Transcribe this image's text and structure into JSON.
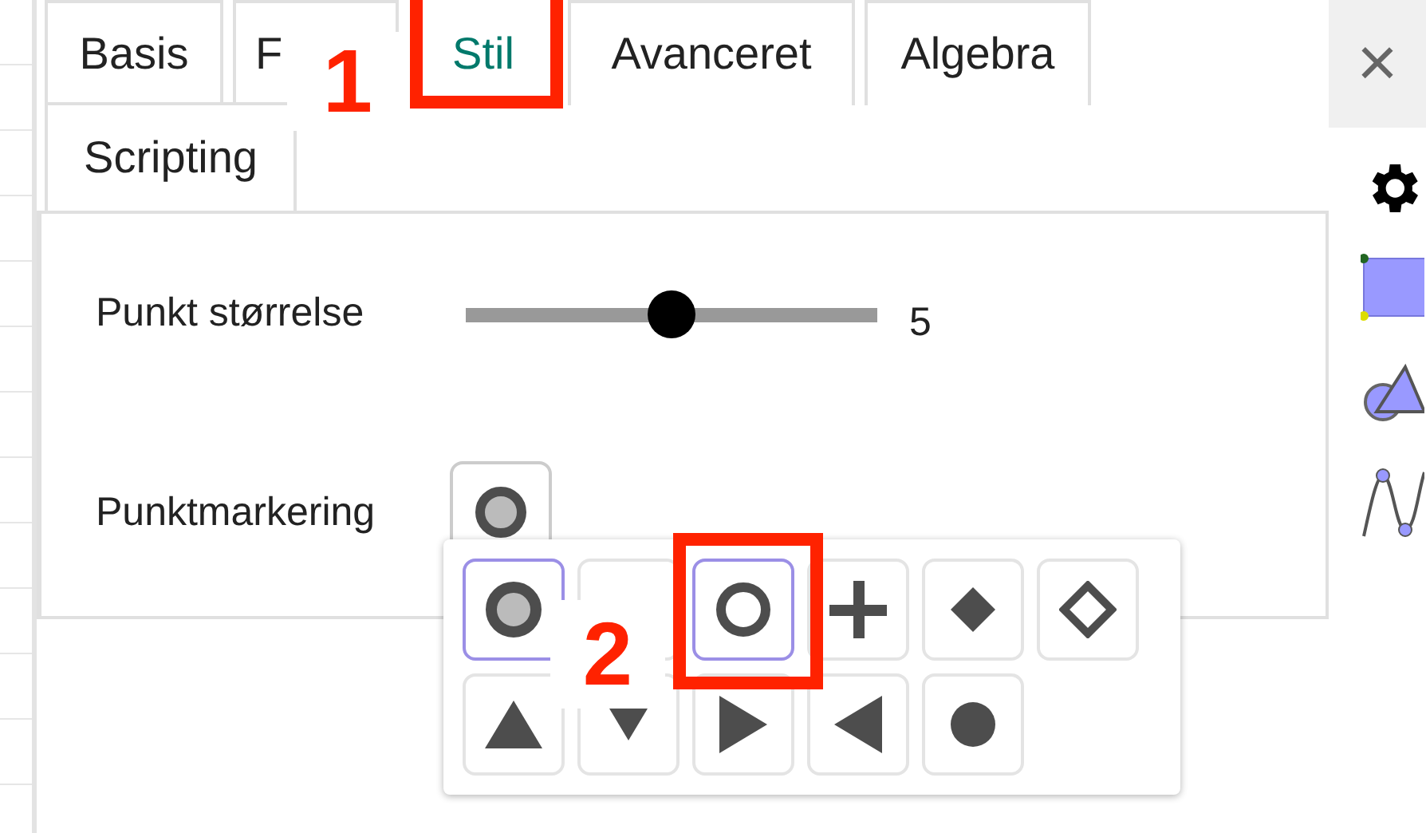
{
  "tab_rows": [
    [
      {
        "label": "Basis",
        "selected": false
      },
      {
        "label": "F",
        "selected": false
      },
      {
        "label": "Stil",
        "selected": true
      },
      {
        "label": "Avanceret",
        "selected": false
      },
      {
        "label": "Algebra",
        "selected": false
      }
    ],
    [
      {
        "label": "Scripting",
        "selected": false
      }
    ]
  ],
  "point_size": {
    "label": "Punkt størrelse",
    "level": 0.5,
    "reading": "5"
  },
  "point_style": {
    "label": "Punktmarkering",
    "kind": "ring_filled"
  },
  "style_options": [
    {
      "kind": "ring_filled",
      "selected": true
    },
    {
      "kind": "obscured",
      "selected": false
    },
    {
      "kind": "ring",
      "selected": true
    },
    {
      "kind": "plus",
      "selected": false
    },
    {
      "kind": "diamond_filled",
      "selected": false
    },
    {
      "kind": "diamond_empty",
      "selected": false
    },
    {
      "kind": "triangle_up",
      "selected": false
    },
    {
      "kind": "triangle_down",
      "selected": false
    },
    {
      "kind": "triangle_right",
      "selected": false
    },
    {
      "kind": "triangle_left",
      "selected": false
    },
    {
      "kind": "dot",
      "selected": false
    }
  ],
  "annotations": [
    {
      "label": "1"
    },
    {
      "label": "2"
    }
  ],
  "close": {
    "label": "×"
  }
}
